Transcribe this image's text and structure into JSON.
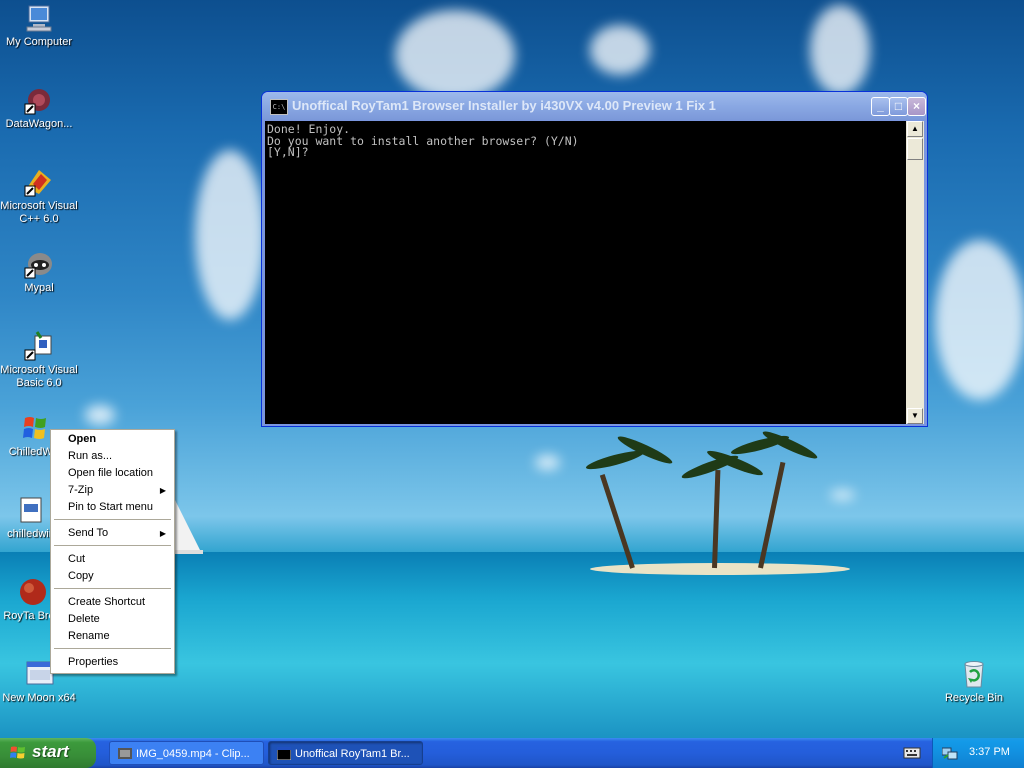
{
  "desktop": {
    "icons": [
      {
        "label": "My Computer",
        "icon": "my-computer-icon"
      },
      {
        "label": "DataWagon...",
        "icon": "datawagon-icon"
      },
      {
        "label": "Microsoft Visual C++ 6.0",
        "icon": "visual-cpp-icon"
      },
      {
        "label": "Mypal",
        "icon": "mypal-icon"
      },
      {
        "label": "Microsoft Visual Basic 6.0",
        "icon": "visual-basic-icon"
      },
      {
        "label": "ChilledWin",
        "icon": "windows-flag-icon"
      },
      {
        "label": "chilledwin",
        "icon": "document-icon"
      },
      {
        "label": "RoyTa Brow",
        "icon": "browser-icon"
      },
      {
        "label": "New Moon x64",
        "icon": "new-moon-icon"
      },
      {
        "label": "Recycle Bin",
        "icon": "recycle-bin-icon"
      }
    ]
  },
  "window": {
    "title": "Unoffical RoyTam1 Browser Installer by i430VX v4.00 Preview 1 Fix 1",
    "app_icon_text": "C:\\",
    "controls": {
      "minimize": "_",
      "maximize": "□",
      "close": "×"
    },
    "console_lines": [
      "Done! Enjoy.",
      "Do you want to install another browser? (Y/N)",
      "[Y,N]?"
    ]
  },
  "context_menu": {
    "items": [
      {
        "label": "Open",
        "bold": true
      },
      {
        "label": "Run as..."
      },
      {
        "label": "Open file location"
      },
      {
        "label": "7-Zip",
        "submenu": true
      },
      {
        "label": "Pin to Start menu"
      },
      {
        "label": "Send To",
        "submenu": true
      },
      {
        "label": "Cut"
      },
      {
        "label": "Copy"
      },
      {
        "label": "Create Shortcut"
      },
      {
        "label": "Delete"
      },
      {
        "label": "Rename"
      },
      {
        "label": "Properties"
      }
    ],
    "submenu_arrow": "▶"
  },
  "taskbar": {
    "start_label": "start",
    "tasks": [
      {
        "label": "IMG_0459.mp4 - Clip...",
        "icon": "clipchamp-icon"
      },
      {
        "label": "Unoffical RoyTam1 Br...",
        "icon": "console-icon"
      }
    ],
    "clock": "3:37 PM"
  },
  "colors": {
    "taskbar_blue": "#245edb",
    "start_green": "#3c9a3c",
    "tray_blue": "#1290e0",
    "console_bg": "#000000",
    "console_text": "#c0c0c0",
    "selection_blue": "#316ac5"
  }
}
